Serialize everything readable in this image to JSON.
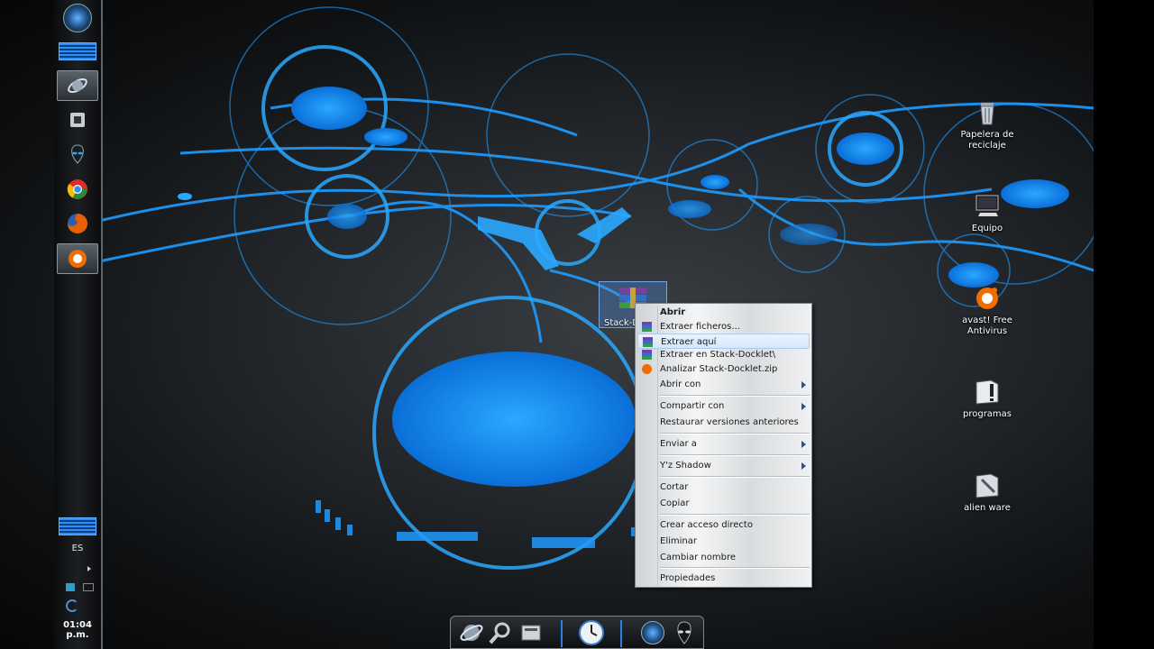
{
  "sidebar": {
    "language": "ES",
    "clock": "01:04 p.m.",
    "icons": [
      "alienware-logo-icon",
      "equalizer-icon",
      "internet-explorer-icon",
      "media-player-icon",
      "alien-head-icon",
      "chrome-icon",
      "firefox-icon",
      "avast-icon"
    ]
  },
  "desktop_icons": {
    "recycle": "Papelera de reciclaje",
    "computer": "Equipo",
    "avast": "avast! Free Antivirus",
    "programas": "programas",
    "alienware": "alien ware"
  },
  "selected_file": {
    "label": "Stack-D"
  },
  "context_menu": {
    "items": [
      {
        "label": "Abrir",
        "bold": true
      },
      {
        "label": "Extraer ficheros..."
      },
      {
        "label": "Extraer aquí",
        "highlighted": true
      },
      {
        "label": "Extraer en Stack-Docklet\\"
      },
      {
        "label": "Analizar Stack-Docklet.zip"
      },
      {
        "label": "Abrir con",
        "submenu": true
      },
      {
        "label": "Compartir con",
        "submenu": true
      },
      {
        "label": "Restaurar versiones anteriores"
      },
      {
        "label": "Enviar a",
        "submenu": true
      },
      {
        "label": "Y'z Shadow",
        "submenu": true
      },
      {
        "label": "Cortar"
      },
      {
        "label": "Copiar"
      },
      {
        "label": "Crear acceso directo"
      },
      {
        "label": "Eliminar"
      },
      {
        "label": "Cambiar nombre"
      },
      {
        "label": "Propiedades"
      }
    ]
  },
  "dock": {
    "icons": [
      "internet-explorer-icon",
      "magnifier-icon",
      "computer-icon",
      "clock-icon",
      "alienware-logo-icon",
      "alien-head-icon"
    ]
  },
  "colors": {
    "accent": "#1e9bff",
    "menu_highlight": "#d4e7fb"
  }
}
